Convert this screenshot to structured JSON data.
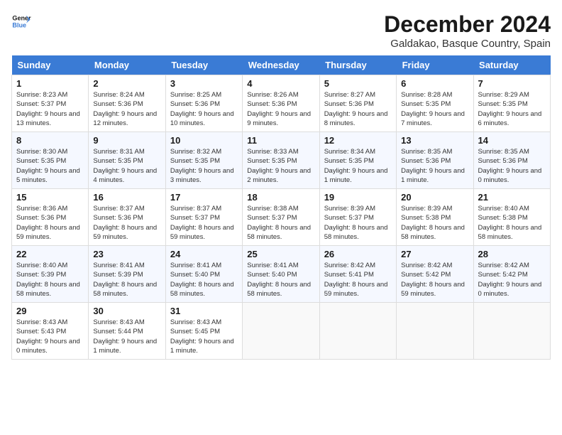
{
  "header": {
    "logo_line1": "General",
    "logo_line2": "Blue",
    "month_title": "December 2024",
    "location": "Galdakao, Basque Country, Spain"
  },
  "weekdays": [
    "Sunday",
    "Monday",
    "Tuesday",
    "Wednesday",
    "Thursday",
    "Friday",
    "Saturday"
  ],
  "weeks": [
    [
      {
        "day": "1",
        "sunrise": "8:23 AM",
        "sunset": "5:37 PM",
        "daylight": "9 hours and 13 minutes."
      },
      {
        "day": "2",
        "sunrise": "8:24 AM",
        "sunset": "5:36 PM",
        "daylight": "9 hours and 12 minutes."
      },
      {
        "day": "3",
        "sunrise": "8:25 AM",
        "sunset": "5:36 PM",
        "daylight": "9 hours and 10 minutes."
      },
      {
        "day": "4",
        "sunrise": "8:26 AM",
        "sunset": "5:36 PM",
        "daylight": "9 hours and 9 minutes."
      },
      {
        "day": "5",
        "sunrise": "8:27 AM",
        "sunset": "5:36 PM",
        "daylight": "9 hours and 8 minutes."
      },
      {
        "day": "6",
        "sunrise": "8:28 AM",
        "sunset": "5:35 PM",
        "daylight": "9 hours and 7 minutes."
      },
      {
        "day": "7",
        "sunrise": "8:29 AM",
        "sunset": "5:35 PM",
        "daylight": "9 hours and 6 minutes."
      }
    ],
    [
      {
        "day": "8",
        "sunrise": "8:30 AM",
        "sunset": "5:35 PM",
        "daylight": "9 hours and 5 minutes."
      },
      {
        "day": "9",
        "sunrise": "8:31 AM",
        "sunset": "5:35 PM",
        "daylight": "9 hours and 4 minutes."
      },
      {
        "day": "10",
        "sunrise": "8:32 AM",
        "sunset": "5:35 PM",
        "daylight": "9 hours and 3 minutes."
      },
      {
        "day": "11",
        "sunrise": "8:33 AM",
        "sunset": "5:35 PM",
        "daylight": "9 hours and 2 minutes."
      },
      {
        "day": "12",
        "sunrise": "8:34 AM",
        "sunset": "5:35 PM",
        "daylight": "9 hours and 1 minute."
      },
      {
        "day": "13",
        "sunrise": "8:35 AM",
        "sunset": "5:36 PM",
        "daylight": "9 hours and 1 minute."
      },
      {
        "day": "14",
        "sunrise": "8:35 AM",
        "sunset": "5:36 PM",
        "daylight": "9 hours and 0 minutes."
      }
    ],
    [
      {
        "day": "15",
        "sunrise": "8:36 AM",
        "sunset": "5:36 PM",
        "daylight": "8 hours and 59 minutes."
      },
      {
        "day": "16",
        "sunrise": "8:37 AM",
        "sunset": "5:36 PM",
        "daylight": "8 hours and 59 minutes."
      },
      {
        "day": "17",
        "sunrise": "8:37 AM",
        "sunset": "5:37 PM",
        "daylight": "8 hours and 59 minutes."
      },
      {
        "day": "18",
        "sunrise": "8:38 AM",
        "sunset": "5:37 PM",
        "daylight": "8 hours and 58 minutes."
      },
      {
        "day": "19",
        "sunrise": "8:39 AM",
        "sunset": "5:37 PM",
        "daylight": "8 hours and 58 minutes."
      },
      {
        "day": "20",
        "sunrise": "8:39 AM",
        "sunset": "5:38 PM",
        "daylight": "8 hours and 58 minutes."
      },
      {
        "day": "21",
        "sunrise": "8:40 AM",
        "sunset": "5:38 PM",
        "daylight": "8 hours and 58 minutes."
      }
    ],
    [
      {
        "day": "22",
        "sunrise": "8:40 AM",
        "sunset": "5:39 PM",
        "daylight": "8 hours and 58 minutes."
      },
      {
        "day": "23",
        "sunrise": "8:41 AM",
        "sunset": "5:39 PM",
        "daylight": "8 hours and 58 minutes."
      },
      {
        "day": "24",
        "sunrise": "8:41 AM",
        "sunset": "5:40 PM",
        "daylight": "8 hours and 58 minutes."
      },
      {
        "day": "25",
        "sunrise": "8:41 AM",
        "sunset": "5:40 PM",
        "daylight": "8 hours and 58 minutes."
      },
      {
        "day": "26",
        "sunrise": "8:42 AM",
        "sunset": "5:41 PM",
        "daylight": "8 hours and 59 minutes."
      },
      {
        "day": "27",
        "sunrise": "8:42 AM",
        "sunset": "5:42 PM",
        "daylight": "8 hours and 59 minutes."
      },
      {
        "day": "28",
        "sunrise": "8:42 AM",
        "sunset": "5:42 PM",
        "daylight": "9 hours and 0 minutes."
      }
    ],
    [
      {
        "day": "29",
        "sunrise": "8:43 AM",
        "sunset": "5:43 PM",
        "daylight": "9 hours and 0 minutes."
      },
      {
        "day": "30",
        "sunrise": "8:43 AM",
        "sunset": "5:44 PM",
        "daylight": "9 hours and 1 minute."
      },
      {
        "day": "31",
        "sunrise": "8:43 AM",
        "sunset": "5:45 PM",
        "daylight": "9 hours and 1 minute."
      },
      null,
      null,
      null,
      null
    ]
  ],
  "labels": {
    "sunrise_prefix": "Sunrise: ",
    "sunset_prefix": "Sunset: ",
    "daylight_prefix": "Daylight: "
  }
}
